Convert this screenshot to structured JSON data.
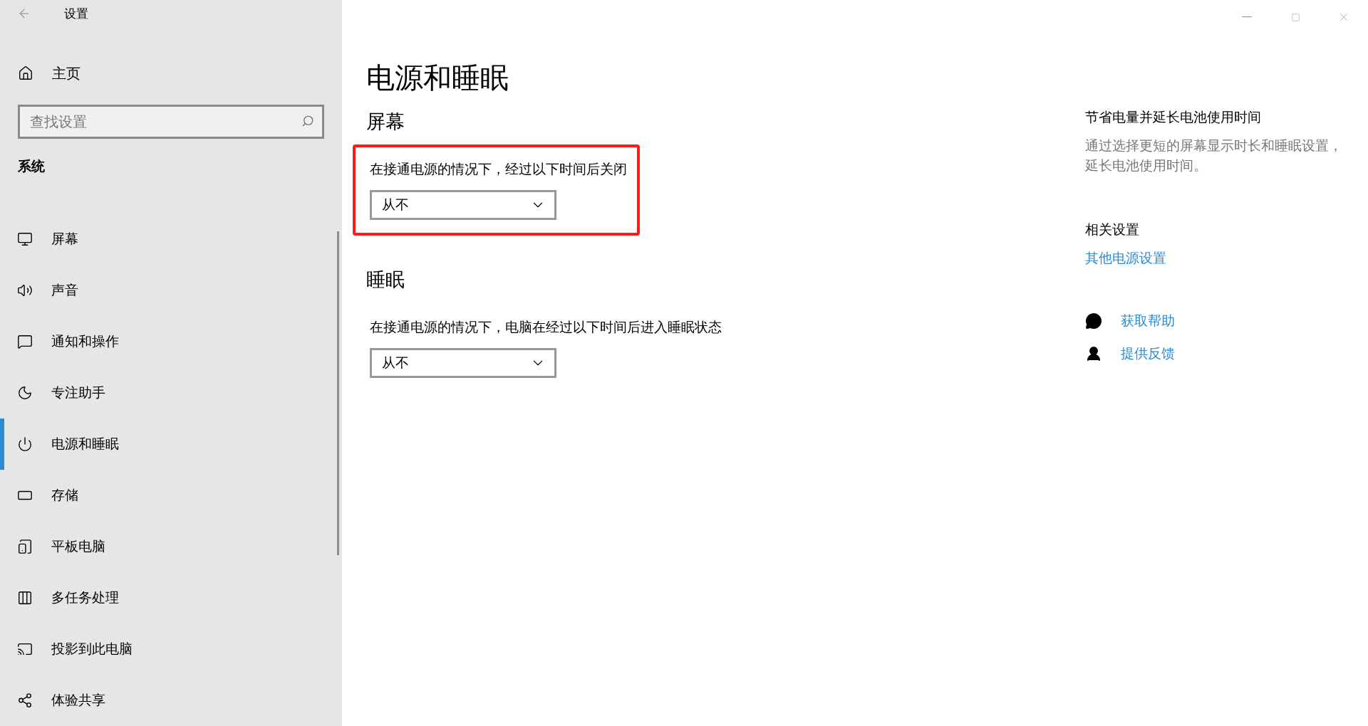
{
  "window": {
    "title": "设置"
  },
  "sidebar": {
    "home": "主页",
    "search": {
      "placeholder": "查找设置"
    },
    "section": "系统",
    "items": [
      {
        "label": "屏幕",
        "selected": false
      },
      {
        "label": "声音",
        "selected": false
      },
      {
        "label": "通知和操作",
        "selected": false
      },
      {
        "label": "专注助手",
        "selected": false
      },
      {
        "label": "电源和睡眠",
        "selected": true
      },
      {
        "label": "存储",
        "selected": false
      },
      {
        "label": "平板电脑",
        "selected": false
      },
      {
        "label": "多任务处理",
        "selected": false
      },
      {
        "label": "投影到此电脑",
        "selected": false
      },
      {
        "label": "体验共享",
        "selected": false
      }
    ]
  },
  "main": {
    "title": "电源和睡眠",
    "sections": [
      {
        "heading": "屏幕",
        "label": "在接通电源的情况下，经过以下时间后关闭",
        "value": "从不",
        "highlighted": true
      },
      {
        "heading": "睡眠",
        "label": "在接通电源的情况下，电脑在经过以下时间后进入睡眠状态",
        "value": "从不",
        "highlighted": false
      }
    ]
  },
  "aside": {
    "heading": "节省电量并延长电池使用时间",
    "description": "通过选择更短的屏幕显示时长和睡眠设置，延长电池使用时间。",
    "related_heading": "相关设置",
    "related_link": "其他电源设置",
    "help_links": [
      "获取帮助",
      "提供反馈"
    ]
  }
}
